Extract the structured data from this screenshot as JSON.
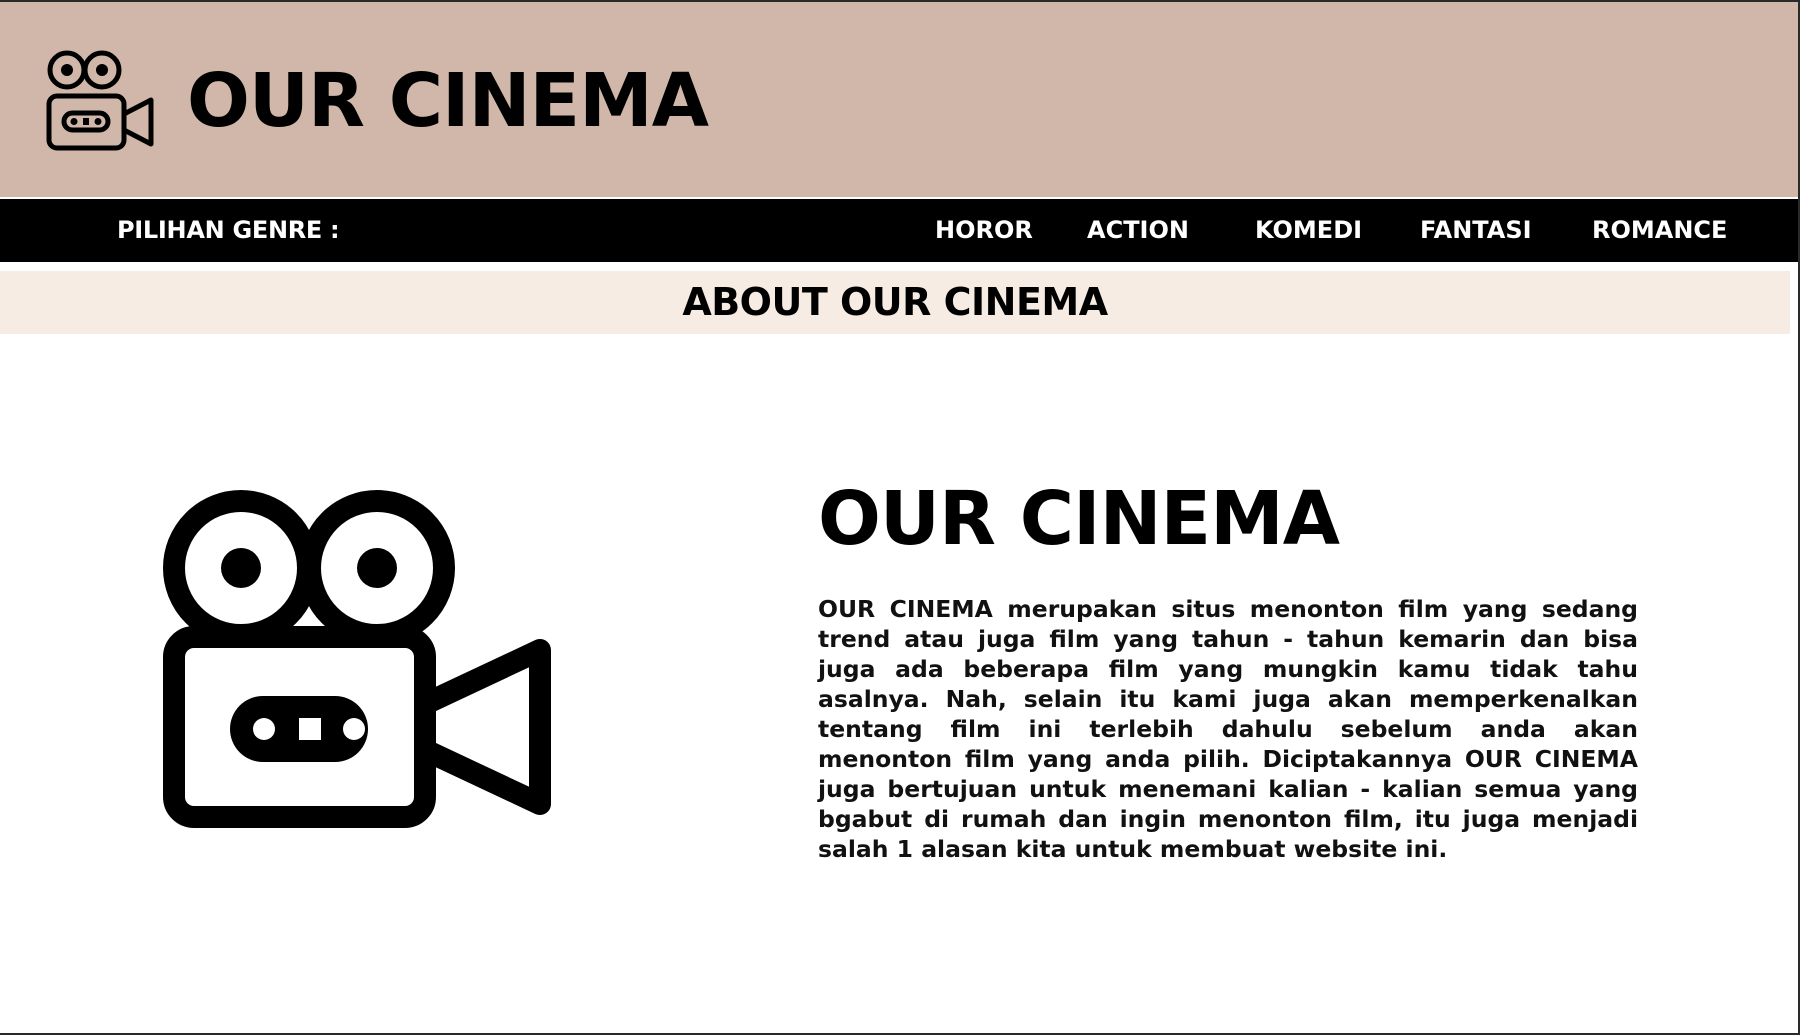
{
  "header": {
    "title": "OUR CINEMA",
    "logo_icon": "movie-camera-icon",
    "background": "#d1b7a9"
  },
  "nav": {
    "label": "PILIHAN GENRE :",
    "background": "#000000",
    "items": [
      {
        "label": "HOROR"
      },
      {
        "label": "ACTION"
      },
      {
        "label": "KOMEDI"
      },
      {
        "label": "FANTASI"
      },
      {
        "label": "ROMANCE"
      }
    ]
  },
  "about": {
    "title": "ABOUT OUR CINEMA",
    "background": "#f6ece3"
  },
  "main": {
    "illustration_icon": "movie-camera-icon",
    "title": "OUR CINEMA",
    "description": "OUR CINEMA merupakan situs menonton film yang sedang trend atau juga film yang tahun - tahun kemarin dan bisa juga ada beberapa film yang mungkin kamu tidak tahu asalnya. Nah, selain itu kami juga akan memperkenalkan tentang film ini terlebih dahulu sebelum anda akan menonton film yang anda pilih. Diciptakannya OUR CINEMA juga bertujuan untuk menemani kalian - kalian semua yang bgabut di rumah dan ingin menonton film, itu juga menjadi salah 1 alasan kita untuk membuat website ini."
  }
}
